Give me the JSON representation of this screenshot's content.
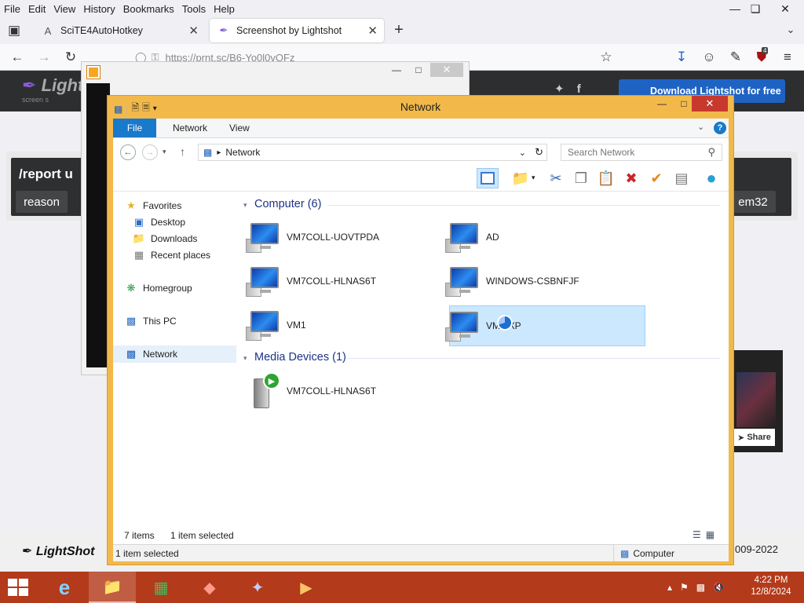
{
  "browser": {
    "menu": [
      "File",
      "Edit",
      "View",
      "History",
      "Bookmarks",
      "Tools",
      "Help"
    ],
    "tabs": [
      {
        "label": "SciTE4AutoHotkey",
        "icon": "A"
      },
      {
        "label": "Screenshot by Lightshot",
        "icon": "feather"
      }
    ],
    "url": "https://prnt.sc/B6-Yo0l0vQFz",
    "extension_badge": "4"
  },
  "lightshot": {
    "logo": "Light",
    "logo_sub": "screen s",
    "download_label": "Download Lightshot for free",
    "report_cmd": "/report u",
    "reason_label": "reason",
    "item32_label": "em32",
    "footer_logo": "LightShot",
    "footer_copy": "009-2022",
    "share_label": "Share"
  },
  "explorer": {
    "title": "Network",
    "ribbon_tabs": {
      "file": "File",
      "network": "Network",
      "view": "View"
    },
    "help": "?",
    "address": "Network",
    "search_placeholder": "Search Network",
    "nav": {
      "favorites": "Favorites",
      "desktop": "Desktop",
      "downloads": "Downloads",
      "recent": "Recent places",
      "homegroup": "Homegroup",
      "thispc": "This PC",
      "network": "Network"
    },
    "groups": {
      "computer": "Computer (6)",
      "media": "Media Devices (1)"
    },
    "computers": [
      "VM7COLL-UOVTPDA",
      "AD",
      "VM7COLL-HLNAS6T",
      "WINDOWS-CSBNFJF",
      "VM1",
      "VM1-XP"
    ],
    "media_devices": [
      "VM7COLL-HLNAS6T"
    ],
    "selected_item": "VM1-XP",
    "status_items": "7 items",
    "status_selected": "1 item selected",
    "bottom_left": "1 item selected",
    "bottom_right": "Computer"
  },
  "taskbar": {
    "time": "4:22 PM",
    "date": "12/8/2024"
  },
  "colors": {
    "taskbar": "#b33a1a",
    "explorer_frame": "#f2b94a",
    "ribbon_file": "#1979ca",
    "selection": "#cce8ff",
    "group_title": "#1e3287"
  }
}
